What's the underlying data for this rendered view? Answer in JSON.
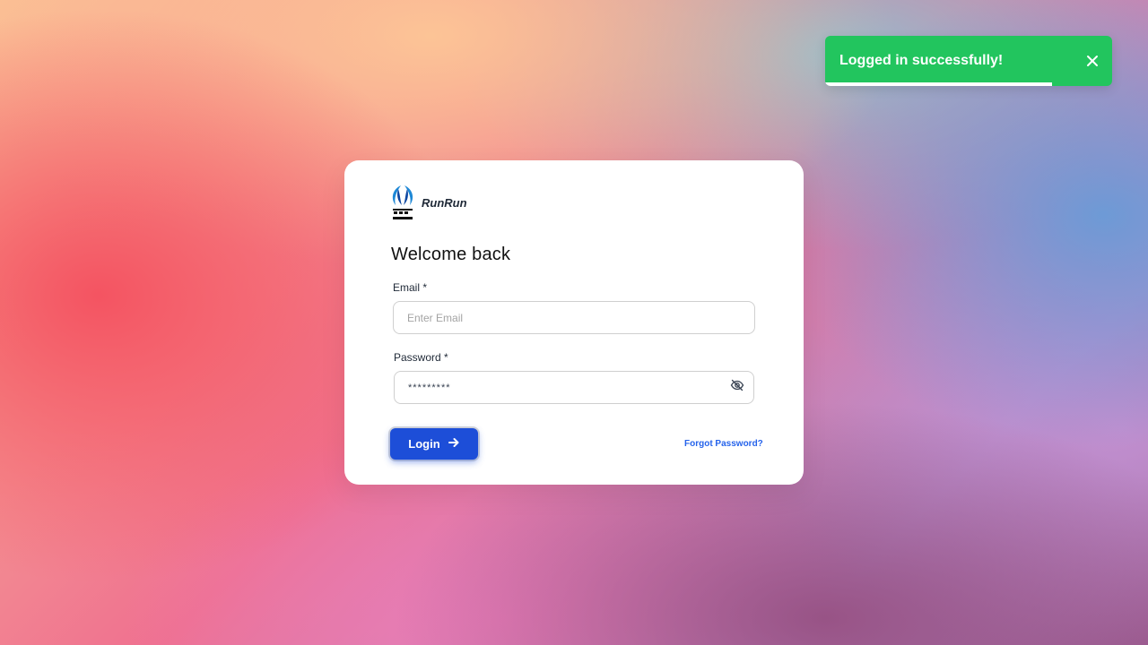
{
  "toast": {
    "message": "Logged in successfully!",
    "progress_percent": 79,
    "color": "#22c55e",
    "close_icon": "close-icon"
  },
  "brand": {
    "name": "RunRun",
    "logo_icon": "railtel-logo"
  },
  "login_form": {
    "title": "Welcome back",
    "email": {
      "label": "Email *",
      "placeholder": "Enter Email",
      "value": ""
    },
    "password": {
      "label": "Password *",
      "value": "*********",
      "toggle_icon": "eye-off-icon"
    },
    "login_button": {
      "label": "Login",
      "icon": "arrow-right-icon",
      "color": "#1d4ed8"
    },
    "forgot_password": "Forgot Password?"
  }
}
